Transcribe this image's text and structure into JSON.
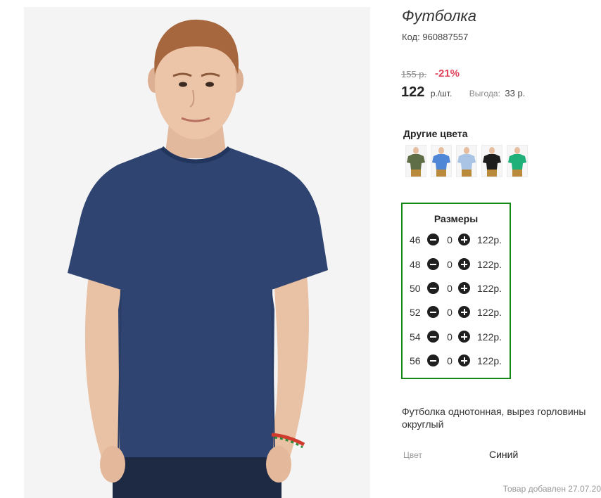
{
  "product": {
    "title": "Футболка",
    "code": "Код: 960887557",
    "old_price": "155 р.",
    "discount": "-21%",
    "price": "122",
    "price_unit": "р./шт.",
    "benefit_label": "Выгода:",
    "benefit_value": "33 р.",
    "description": "Футболка однотонная, вырез горловины округлый",
    "color_label": "Цвет",
    "color_value": "Синий",
    "added_date": "Товар добавлен 27.07.20"
  },
  "colors": {
    "title": "Другие цвета",
    "swatches": [
      {
        "name": "olive",
        "hex": "#5f6e47"
      },
      {
        "name": "blue",
        "hex": "#4f86d6"
      },
      {
        "name": "light-blue",
        "hex": "#a9c4e4"
      },
      {
        "name": "black",
        "hex": "#1d1d1d"
      },
      {
        "name": "green",
        "hex": "#1fb07a"
      }
    ]
  },
  "sizes": {
    "title": "Размеры",
    "rows": [
      {
        "size": "46",
        "qty": "0",
        "price": "122р."
      },
      {
        "size": "48",
        "qty": "0",
        "price": "122р."
      },
      {
        "size": "50",
        "qty": "0",
        "price": "122р."
      },
      {
        "size": "52",
        "qty": "0",
        "price": "122р."
      },
      {
        "size": "54",
        "qty": "0",
        "price": "122р."
      },
      {
        "size": "56",
        "qty": "0",
        "price": "122р."
      }
    ]
  },
  "colors_theme": {
    "accent_green": "#138a17",
    "discount_red": "#e0435b",
    "shirt_navy": "#2f4470",
    "cart_lime": "#c8f26a"
  }
}
